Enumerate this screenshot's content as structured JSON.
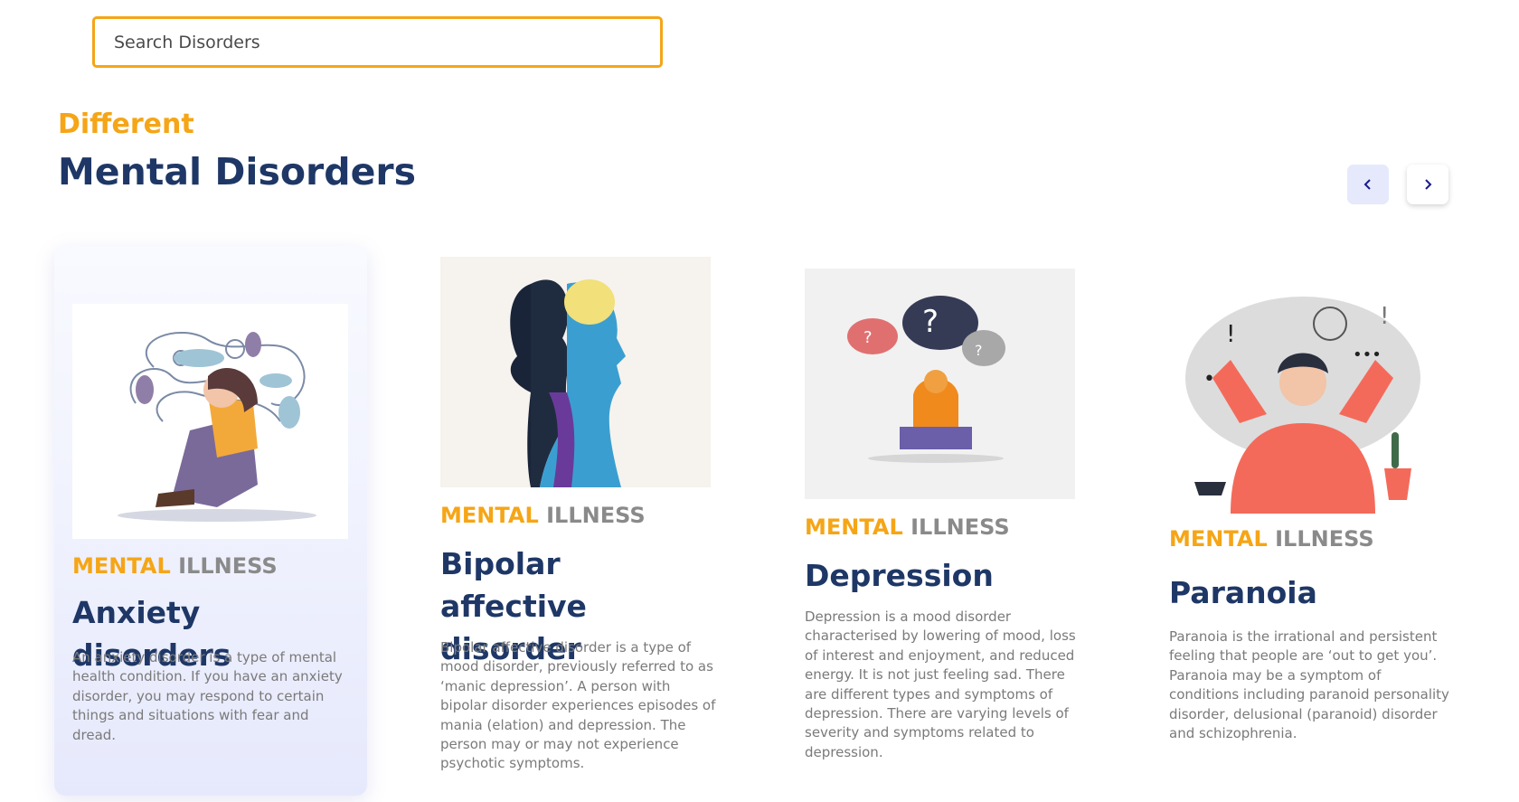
{
  "search": {
    "placeholder": "Search Disorders"
  },
  "section": {
    "eyebrow": "Different",
    "title": "Mental Disorders"
  },
  "nav": {
    "prev_icon": "chevron-left-icon",
    "next_icon": "chevron-right-icon"
  },
  "cards": [
    {
      "label_accent": "MENTAL",
      "label_rest": "ILLNESS",
      "title": "Anxiety disorders",
      "description": "An anxiety disorder is a type of mental health condition. If you have an anxiety disorder, you may respond to certain things and situations with fear and dread."
    },
    {
      "label_accent": "MENTAL",
      "label_rest": "ILLNESS",
      "title": "Bipolar affective disorder",
      "description": "Bipolar affective disorder is a type of mood disorder, previously referred to as ‘manic depression’. A person with bipolar disorder experiences episodes of mania (elation) and depression. The person may or may not experience psychotic symptoms."
    },
    {
      "label_accent": "MENTAL",
      "label_rest": "ILLNESS",
      "title": "Depression",
      "description": "Depression is a mood disorder characterised by lowering of mood, loss of interest and enjoyment, and reduced energy. It is not just feeling sad. There are different types and symptoms of depression. There are varying levels of severity and symptoms related to depression."
    },
    {
      "label_accent": "MENTAL",
      "label_rest": "ILLNESS",
      "title": "Paranoia",
      "description": "Paranoia is the irrational and persistent feeling that people are ‘out to get you’. Paranoia may be a symptom of conditions including paranoid personality disorder, delusional (paranoid) disorder and schizophrenia."
    }
  ],
  "colors": {
    "accent": "#f5a516",
    "navy": "#1e3766",
    "gray_text": "#7a7a7a"
  }
}
